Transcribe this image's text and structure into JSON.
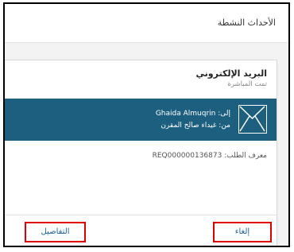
{
  "header": {
    "title": "الأحداث النشطة"
  },
  "card": {
    "title": "البريد الإلكتروني",
    "subtitle": "تمت المباشرة",
    "email": {
      "to_label": "إلى: Ghaida Almuqrin",
      "from_label": "من: غيداء صالح المقرن"
    },
    "request_id_label": "معرف الطلب: REQ000000136873"
  },
  "footer": {
    "details_label": "التفاصيل",
    "cancel_label": "إلغاء"
  },
  "colors": {
    "banner": "#1d5f7e",
    "link": "#1c5f9c",
    "highlight_border": "#e00000"
  },
  "icons": {
    "mail": "envelope-icon"
  }
}
